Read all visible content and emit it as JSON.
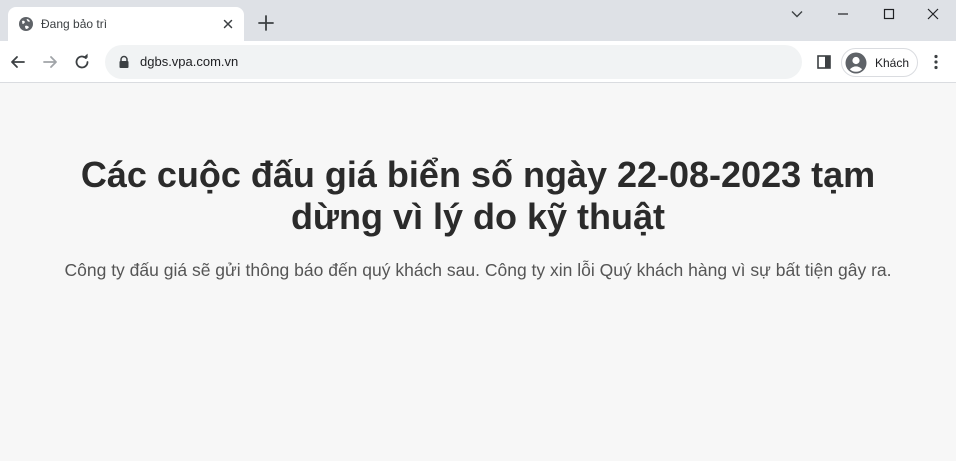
{
  "browser": {
    "tab": {
      "title": "Đang bảo trì",
      "favicon": "globe-icon"
    },
    "omnibox": {
      "url": "dgbs.vpa.com.vn"
    },
    "profile": {
      "label": "Khách"
    }
  },
  "page": {
    "headline": "Các cuộc đấu giá biển số ngày 22-08-2023 tạm dừng vì lý do kỹ thuật",
    "message": "Công ty đấu giá sẽ gửi thông báo đến quý khách sau. Công ty xin lỗi Quý khách hàng vì sự bất tiện gây ra."
  },
  "colors": {
    "tabstrip": "#dee1e6",
    "page_background": "#f7f7f7",
    "headline": "#2b2b2b",
    "message": "#555555"
  }
}
